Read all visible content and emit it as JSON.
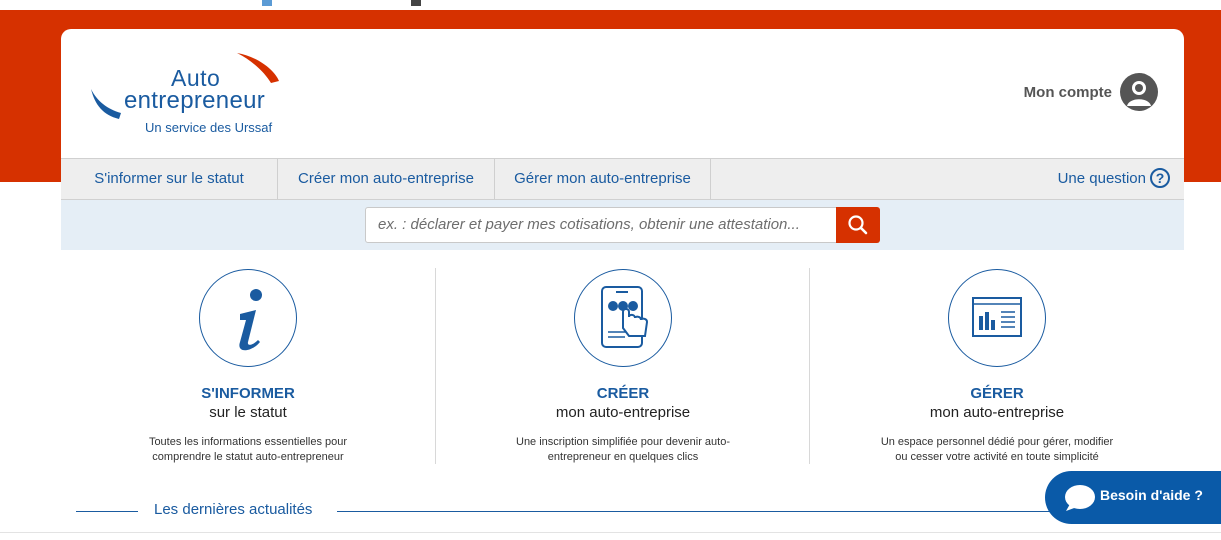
{
  "logo": {
    "line1": "Auto",
    "line2": "entrepreneur",
    "tagline": "Un service des Urssaf",
    "colors": {
      "blue": "#1a5ba0",
      "red": "#d63100"
    }
  },
  "account": {
    "label": "Mon compte",
    "icon": "user-avatar-icon"
  },
  "nav": {
    "tabs": [
      {
        "label": "S'informer sur le statut"
      },
      {
        "label": "Créer mon auto-entreprise"
      },
      {
        "label": "Gérer mon auto-entreprise"
      }
    ],
    "question": {
      "label": "Une question",
      "icon_glyph": "?"
    }
  },
  "search": {
    "placeholder": "ex. : déclarer et payer mes cotisations, obtenir une attestation...",
    "button_icon": "search-icon"
  },
  "features": [
    {
      "icon": "info-icon",
      "title": "S'INFORMER",
      "subtitle": "sur le statut",
      "description": "Toutes les informations essentielles pour comprendre le statut auto-entrepreneur"
    },
    {
      "icon": "tablet-touch-icon",
      "title": "CRÉER",
      "subtitle": "mon auto-entreprise",
      "description": "Une inscription simplifiée pour devenir auto-entrepreneur en quelques clics"
    },
    {
      "icon": "dashboard-chart-icon",
      "title": "GÉRER",
      "subtitle": "mon auto-entreprise",
      "description": "Un espace personnel dédié pour gérer, modifier ou cesser votre activité en toute simplicité"
    }
  ],
  "news": {
    "label": "Les dernières actualités"
  },
  "help": {
    "label": "Besoin d'aide ?",
    "icon": "chat-bubble-icon"
  },
  "colors": {
    "brand_red": "#d63100",
    "brand_blue": "#1a5ba0",
    "nav_bg": "#eeeeee",
    "search_bg": "#e5eef6",
    "help_bg": "#0a5aa8"
  }
}
